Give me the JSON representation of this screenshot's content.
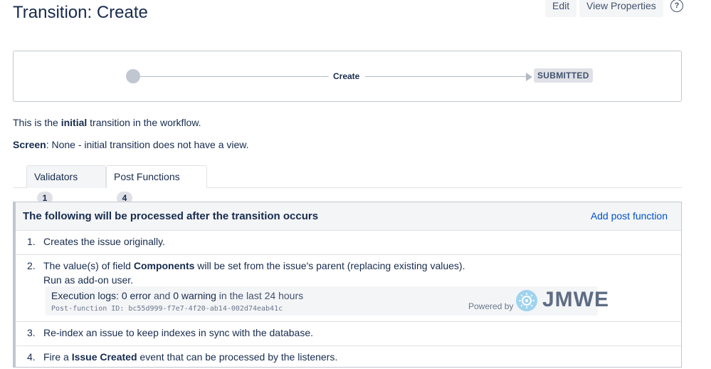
{
  "page": {
    "title": "Transition: Create"
  },
  "toolbar": {
    "edit_label": "Edit",
    "view_properties_label": "View Properties",
    "help_symbol": "?"
  },
  "diagram": {
    "transition_label": "Create",
    "target_status": "SUBMITTED"
  },
  "info": {
    "initial_prefix": "This is the ",
    "initial_bold": "initial",
    "initial_suffix": " transition in the workflow.",
    "screen_label": "Screen",
    "screen_value": ": None - initial transition does not have a view."
  },
  "tabs": [
    {
      "label": "Validators",
      "count": "1",
      "active": false
    },
    {
      "label": "Post Functions",
      "count": "4",
      "active": true
    }
  ],
  "post_functions": {
    "header": "The following will be processed after the transition occurs",
    "add_label": "Add post function",
    "items": [
      {
        "number": "1.",
        "text": "Creates the issue originally."
      },
      {
        "number": "2.",
        "text_prefix": "The value(s) of field ",
        "text_bold": "Components",
        "text_suffix": " will be set from the issue's parent (replacing existing values).",
        "run_as": "Run as add-on user.",
        "exec": {
          "prefix": "Execution logs: ",
          "errors": "0 error",
          "and": " and ",
          "warnings": "0 warning",
          "suffix": " in the last 24 hours",
          "function_id": "Post-function ID: bc55d999-f7e7-4f20-ab14-002d74eab41c",
          "powered_by": "Powered by",
          "brand": "JMWE"
        }
      },
      {
        "number": "3.",
        "text": "Re-index an issue to keep indexes in sync with the database."
      },
      {
        "number": "4.",
        "text_prefix": "Fire a ",
        "text_bold": "Issue Created",
        "text_suffix": " event that can be processed by the listeners."
      }
    ]
  }
}
